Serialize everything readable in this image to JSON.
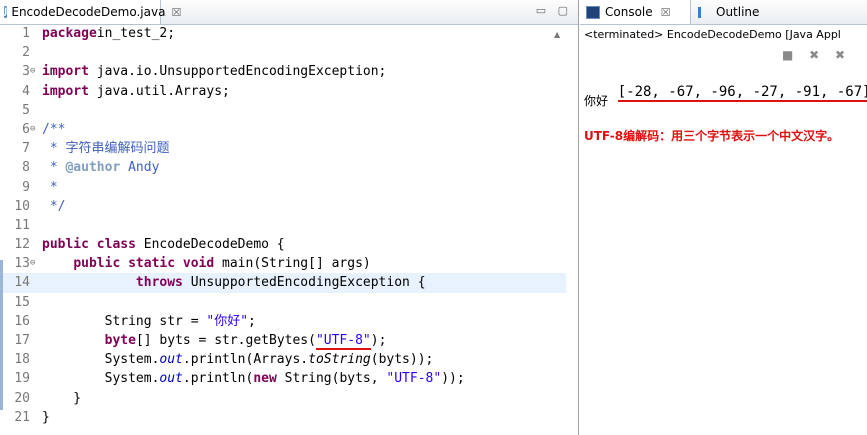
{
  "editor": {
    "tab_title": "EncodeDecodeDemo.java",
    "tab_close": "☒",
    "window_buttons": "▭ ▢",
    "lines": [
      {
        "n": "1",
        "parts": [
          [
            "kw",
            "package"
          ],
          [
            "",
            "in_test_2;"
          ]
        ]
      },
      {
        "n": "2",
        "parts": []
      },
      {
        "n": "3",
        "fold": "⊖",
        "parts": [
          [
            "kw",
            "import"
          ],
          [
            "",
            " java.io.UnsupportedEncodingException;"
          ]
        ]
      },
      {
        "n": "4",
        "parts": [
          [
            "kw",
            "import"
          ],
          [
            "",
            " java.util.Arrays;"
          ]
        ]
      },
      {
        "n": "5",
        "parts": []
      },
      {
        "n": "6",
        "fold": "⊖",
        "parts": [
          [
            "jd",
            "/**"
          ]
        ]
      },
      {
        "n": "7",
        "parts": [
          [
            "jd",
            " * 字符串编解码问题"
          ]
        ]
      },
      {
        "n": "8",
        "parts": [
          [
            "jd",
            " * "
          ],
          [
            "tag",
            "@author"
          ],
          [
            "jd",
            " Andy"
          ]
        ]
      },
      {
        "n": "9",
        "parts": [
          [
            "jd",
            " *"
          ]
        ]
      },
      {
        "n": "10",
        "parts": [
          [
            "jd",
            " */"
          ]
        ]
      },
      {
        "n": "11",
        "parts": []
      },
      {
        "n": "12",
        "parts": [
          [
            "kw",
            "public class"
          ],
          [
            "",
            " EncodeDecodeDemo {"
          ]
        ]
      },
      {
        "n": "13",
        "fold": "⊖",
        "parts": [
          [
            "",
            "    "
          ],
          [
            "kw",
            "public static void"
          ],
          [
            "",
            " main(String[] args)"
          ]
        ]
      },
      {
        "n": "14",
        "hl": true,
        "parts": [
          [
            "",
            "            "
          ],
          [
            "kw",
            "throws"
          ],
          [
            "",
            " UnsupportedEncodingException {"
          ]
        ]
      },
      {
        "n": "15",
        "parts": []
      },
      {
        "n": "16",
        "parts": [
          [
            "",
            "        String str = "
          ],
          [
            "str",
            "\"你好\""
          ],
          [
            "",
            ";"
          ]
        ]
      },
      {
        "n": "17",
        "parts": [
          [
            "",
            "        "
          ],
          [
            "kw",
            "byte"
          ],
          [
            "",
            "[] byts = str.getBytes("
          ],
          [
            "str ul",
            "\"UTF-8\""
          ],
          [
            "",
            ");"
          ]
        ]
      },
      {
        "n": "18",
        "parts": [
          [
            "",
            "        System."
          ],
          [
            "it",
            "out"
          ],
          [
            "",
            ".println(Arrays."
          ],
          [
            "itm",
            "toString"
          ],
          [
            "",
            "(byts));"
          ]
        ]
      },
      {
        "n": "19",
        "parts": [
          [
            "",
            "        System."
          ],
          [
            "it",
            "out"
          ],
          [
            "",
            ".println("
          ],
          [
            "kw",
            "new"
          ],
          [
            "",
            " String(byts, "
          ],
          [
            "str",
            "\"UTF-8\""
          ],
          [
            "",
            "));"
          ]
        ]
      },
      {
        "n": "20",
        "parts": [
          [
            "",
            "    }"
          ]
        ]
      },
      {
        "n": "21",
        "parts": [
          [
            "",
            "}"
          ]
        ]
      }
    ]
  },
  "console": {
    "tab_label": "Console",
    "tab_close": "☒",
    "outline_label": "Outline",
    "status": "<terminated> EncodeDecodeDemo [Java Appl",
    "tools": "■ ✖ ✖",
    "output_line1": "[-28, -67, -96, -27, -91, -67]",
    "output_line2": "你好",
    "note": "UTF-8编解码：用三个字节表示一个中文汉字。"
  }
}
